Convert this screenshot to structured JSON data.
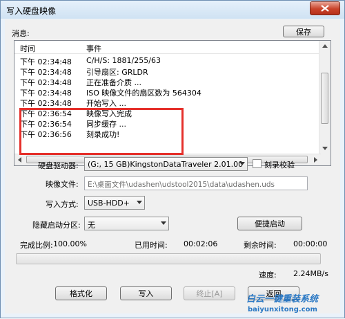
{
  "window": {
    "title": "写入硬盘映像"
  },
  "messages": {
    "label": "消息:",
    "save_button": "保存",
    "columns": {
      "time": "时间",
      "event": "事件"
    },
    "rows": [
      {
        "time": "下午 02:34:48",
        "event": "C/H/S: 1881/255/63"
      },
      {
        "time": "下午 02:34:48",
        "event": "引导扇区: GRLDR"
      },
      {
        "time": "下午 02:34:48",
        "event": "正在准备介质 ..."
      },
      {
        "time": "下午 02:34:48",
        "event": "ISO 映像文件的扇区数为 564304"
      },
      {
        "time": "下午 02:34:48",
        "event": "开始写入 ..."
      },
      {
        "time": "下午 02:36:54",
        "event": "映像写入完成"
      },
      {
        "time": "下午 02:36:54",
        "event": "同步缓存 ..."
      },
      {
        "time": "下午 02:36:56",
        "event": "刻录成功!"
      }
    ]
  },
  "form": {
    "drive_label": "硬盘驱动器:",
    "drive_value": "(G:, 15 GB)KingstonDataTraveler 2.01.00",
    "verify_label": "刻录校验",
    "image_label": "映像文件:",
    "image_value": "E:\\桌面文件\\udashen\\udstool2015\\data\\udashen.uds",
    "write_mode_label": "写入方式:",
    "write_mode_value": "USB-HDD+",
    "hidden_partition_label": "隐藏启动分区:",
    "hidden_partition_value": "无",
    "boot_button": "便捷启动"
  },
  "status": {
    "completion_label": "完成比例:",
    "completion_value": "100.00%",
    "elapsed_label": "已用时间:",
    "elapsed_value": "00:02:06",
    "remaining_label": "剩余时间:",
    "remaining_value": "00:00:00",
    "progress_fraction": 0.0,
    "speed_label": "速度:",
    "speed_value": "2.24MB/s"
  },
  "actions": {
    "format": "格式化",
    "write": "写入",
    "abort": "终止[A]",
    "back": "返回"
  },
  "watermark": {
    "text_cn": "白云一键重装系统",
    "url": "baiyunxitong.com"
  },
  "colors": {
    "highlight_border": "#e5302b",
    "watermark": "#2a78c4",
    "close_button": "#c9432a"
  }
}
